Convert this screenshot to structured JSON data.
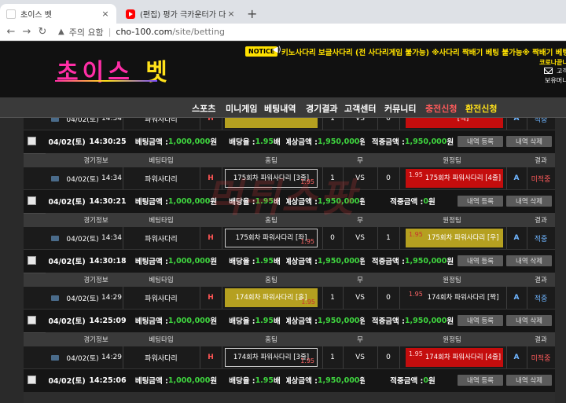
{
  "browser": {
    "tabs": [
      {
        "title": "초이스 벳",
        "close": "×"
      },
      {
        "title": "(편집) 평가 극카운터가 다리우스",
        "close": "×"
      }
    ],
    "new_tab": "+",
    "address": {
      "warning": "주의 요함",
      "host": "cho-100.com",
      "path": "/site/betting"
    }
  },
  "site": {
    "logo_part1": "초이스",
    "logo_part2": "벳",
    "notice_label": "NOTICE",
    "notice_text": "키노사다리 보글사다리 (전 사다리게임 불가능) ※사다리 짝배기 베팅 불가능※ 짝배기 베팅 적발시 전액",
    "side_line1": "코로나끝나",
    "side_line2": "고객",
    "side_line3": "보유머니",
    "nav": [
      "스포츠",
      "미니게임",
      "베팅내역",
      "경기결과",
      "고객센터",
      "커뮤니티",
      "충전신청",
      "환전신청"
    ]
  },
  "headers": {
    "game_info": "경기정보",
    "bet_type": "베팅타입",
    "home": "홈팀",
    "draw": "무",
    "away": "원정팀",
    "result": "결과"
  },
  "labels": {
    "bet_amount": "베팅금액 : ",
    "odds_rate": "배당율 : ",
    "expected": "예상금액 : ",
    "won": "적중금액 : ",
    "btn_register": "내역 등록",
    "btn_delete": "내역 삭제",
    "vs": "VS",
    "h": "H",
    "a": "A",
    "game_logo": "POWERBALL"
  },
  "bets": [
    {
      "date": "04/02(토)",
      "time": "14:34",
      "type": "파워사다리",
      "home": "",
      "home_odds": "",
      "home_score": "1",
      "away": "[짝]",
      "away_odds": "",
      "away_score": "0",
      "result": "적중",
      "sum_date": "04/02(토)",
      "sum_time": "14:30:25",
      "bet_amount": "1,000,000",
      "bet_amount_unit": "원",
      "odds": "1.95",
      "odds_unit": "배",
      "expected": "1,950,000",
      "expected_unit": "원",
      "won": "1,950,000",
      "won_unit": "원"
    },
    {
      "date": "04/02(토)",
      "time": "14:34",
      "type": "파워사다리",
      "home": "175회차 파워사다리 [3줄]",
      "home_odds": "1.95",
      "home_score": "1",
      "away": "175회차 파워사다리 [4줄]",
      "away_odds": "1.95",
      "away_score": "0",
      "result": "미적중",
      "sum_date": "04/02(토)",
      "sum_time": "14:30:21",
      "bet_amount": "1,000,000",
      "bet_amount_unit": "원",
      "odds": "1.95",
      "odds_unit": "배",
      "expected": "1,950,000",
      "expected_unit": "원",
      "won": "0",
      "won_unit": "원"
    },
    {
      "date": "04/02(토)",
      "time": "14:34",
      "type": "파워사다리",
      "home": "175회차 파워사다리 [좌]",
      "home_odds": "1.95",
      "home_score": "0",
      "away": "175회차 파워사다리 [우]",
      "away_odds": "1.95",
      "away_score": "1",
      "result": "적중",
      "sum_date": "04/02(토)",
      "sum_time": "14:30:18",
      "bet_amount": "1,000,000",
      "bet_amount_unit": "원",
      "odds": "1.95",
      "odds_unit": "배",
      "expected": "1,950,000",
      "expected_unit": "원",
      "won": "1,950,000",
      "won_unit": "원"
    },
    {
      "date": "04/02(토)",
      "time": "14:29",
      "type": "파워사다리",
      "home": "174회차 파워사다리 [홀]",
      "home_odds": "1.95",
      "home_score": "1",
      "away": "174회차 파워사다리 [짝]",
      "away_odds": "1.95",
      "away_score": "0",
      "result": "적중",
      "sum_date": "04/02(토)",
      "sum_time": "14:25:09",
      "bet_amount": "1,000,000",
      "bet_amount_unit": "원",
      "odds": "1.95",
      "odds_unit": "배",
      "expected": "1,950,000",
      "expected_unit": "원",
      "won": "1,950,000",
      "won_unit": "원"
    },
    {
      "date": "04/02(토)",
      "time": "14:29",
      "type": "파워사다리",
      "home": "174회차 파워사다리 [3줄]",
      "home_odds": "1.95",
      "home_score": "1",
      "away": "174회차 파워사다리 [4줄]",
      "away_odds": "1.95",
      "away_score": "0",
      "result": "미적중",
      "sum_date": "04/02(토)",
      "sum_time": "14:25:06",
      "bet_amount": "1,000,000",
      "bet_amount_unit": "원",
      "odds": "1.95",
      "odds_unit": "배",
      "expected": "1,950,000",
      "expected_unit": "원",
      "won": "0",
      "won_unit": "원"
    }
  ],
  "watermark": "먹튀스팟"
}
